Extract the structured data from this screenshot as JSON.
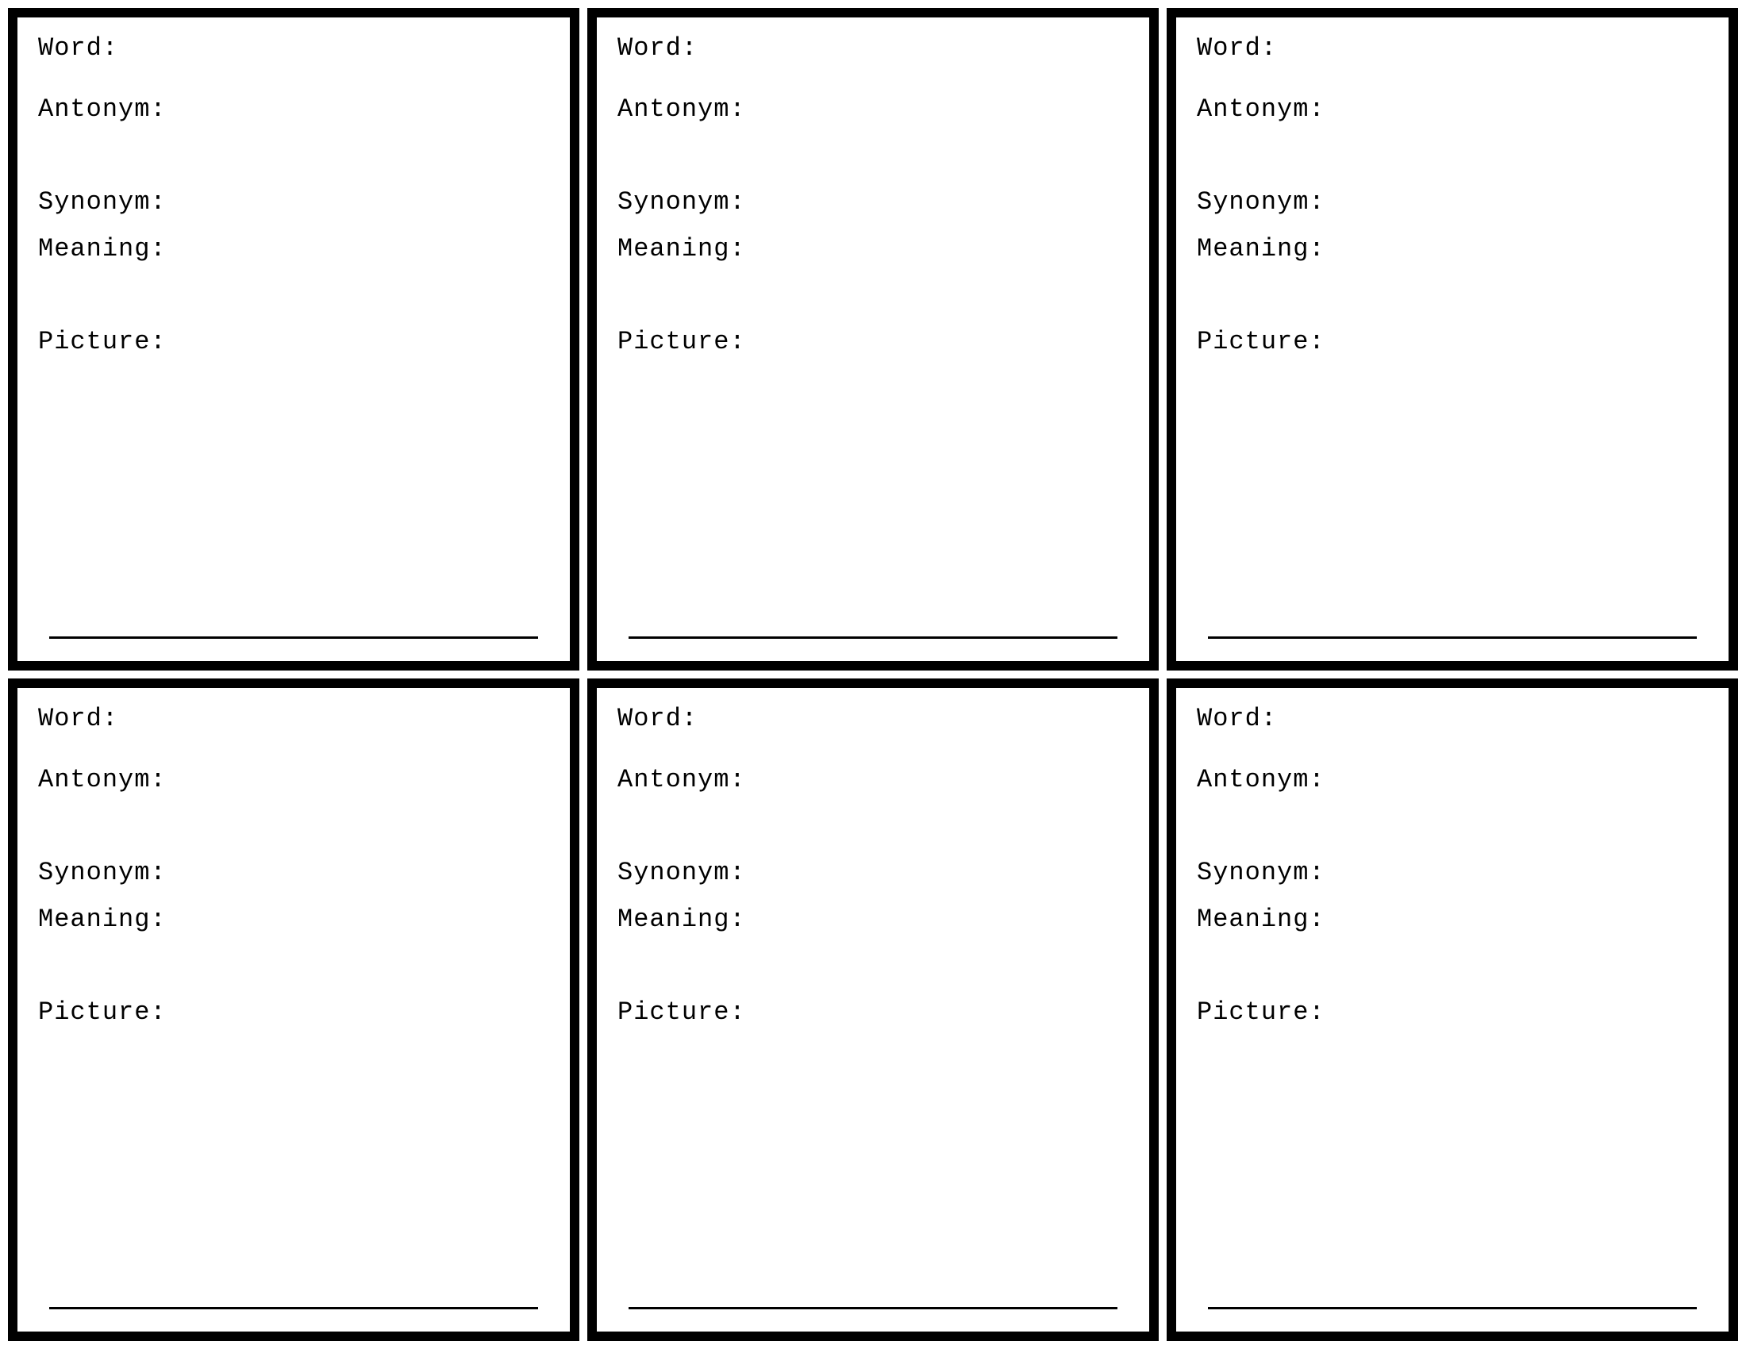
{
  "labels": {
    "word": "Word:",
    "antonym": "Antonym:",
    "synonym": "Synonym:",
    "meaning": "Meaning:",
    "picture": "Picture:",
    "underline": "___________________________"
  },
  "cards": [
    0,
    1,
    2,
    3,
    4,
    5
  ]
}
